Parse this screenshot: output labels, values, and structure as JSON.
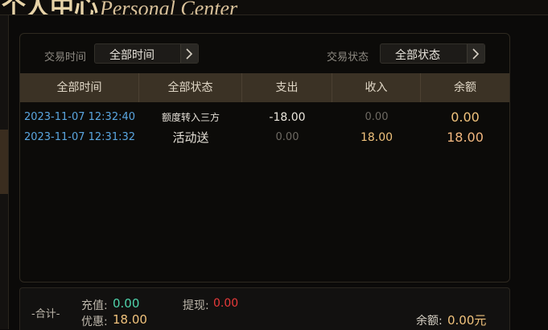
{
  "header": {
    "title_cn": "个人中心",
    "title_en": "Personal Center"
  },
  "filters": {
    "time_label": "交易时间",
    "time_value": "全部时间",
    "status_label": "交易状态",
    "status_value": "全部状态",
    "arrow_icon": "chevron-right-icon"
  },
  "table": {
    "columns": [
      "全部时间",
      "全部状态",
      "支出",
      "收入",
      "余额"
    ],
    "rows": [
      {
        "time": "2023-11-07 12:32:40",
        "status": "额度转入三方",
        "expense": "-18.00",
        "income": "0.00",
        "balance": "0.00"
      },
      {
        "time": "2023-11-07 12:31:32",
        "status": "活动送",
        "expense": "0.00",
        "income": "18.00",
        "balance": "18.00"
      }
    ]
  },
  "footer": {
    "total_label": "-合计-",
    "recharge_label": "充值:",
    "recharge_value": "0.00",
    "withdraw_label": "提现:",
    "withdraw_value": "0.00",
    "promo_label": "优惠:",
    "promo_value": "18.00",
    "balance_label": "余额:",
    "balance_value": "0.00元"
  },
  "colors": {
    "accent_gold": "#f0c27c",
    "time_blue": "#5aa6e0",
    "green": "#4fd3ab",
    "red": "#ea3a3a",
    "header_bg": "#3b3225"
  }
}
